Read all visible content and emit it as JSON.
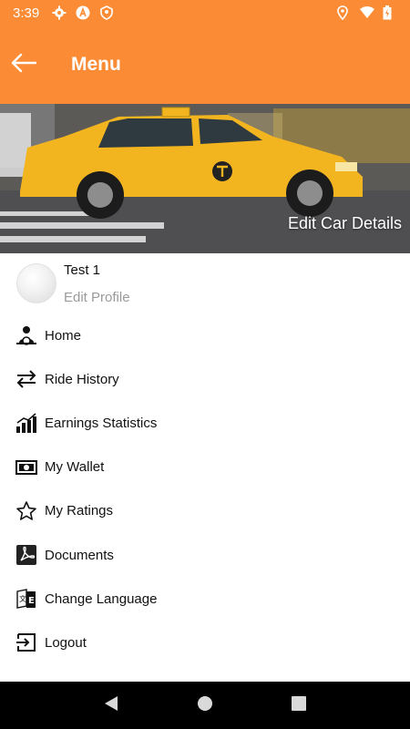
{
  "status_bar": {
    "time": "3:39",
    "left_icons": [
      "gear-icon",
      "a-icon",
      "shield-location-icon"
    ],
    "right_icons": [
      "location-icon",
      "wifi-icon",
      "battery-icon"
    ]
  },
  "app_bar": {
    "title": "Menu",
    "back_icon": "arrow-left-icon"
  },
  "banner": {
    "action_label": "Edit Car Details"
  },
  "profile": {
    "name": "Test 1",
    "edit_label": "Edit Profile"
  },
  "menu": {
    "items": [
      {
        "label": "Home",
        "icon": "driver-icon"
      },
      {
        "label": "Ride History",
        "icon": "swap-arrows-icon"
      },
      {
        "label": "Earnings Statistics",
        "icon": "bar-chart-icon"
      },
      {
        "label": "My Wallet",
        "icon": "money-icon"
      },
      {
        "label": "My Ratings",
        "icon": "star-icon"
      },
      {
        "label": "Documents",
        "icon": "pdf-icon"
      },
      {
        "label": "Change Language",
        "icon": "language-icon"
      },
      {
        "label": "Logout",
        "icon": "logout-icon"
      }
    ]
  },
  "colors": {
    "accent": "#FB8C35",
    "text": "#111111",
    "muted": "#9a9a9a"
  }
}
